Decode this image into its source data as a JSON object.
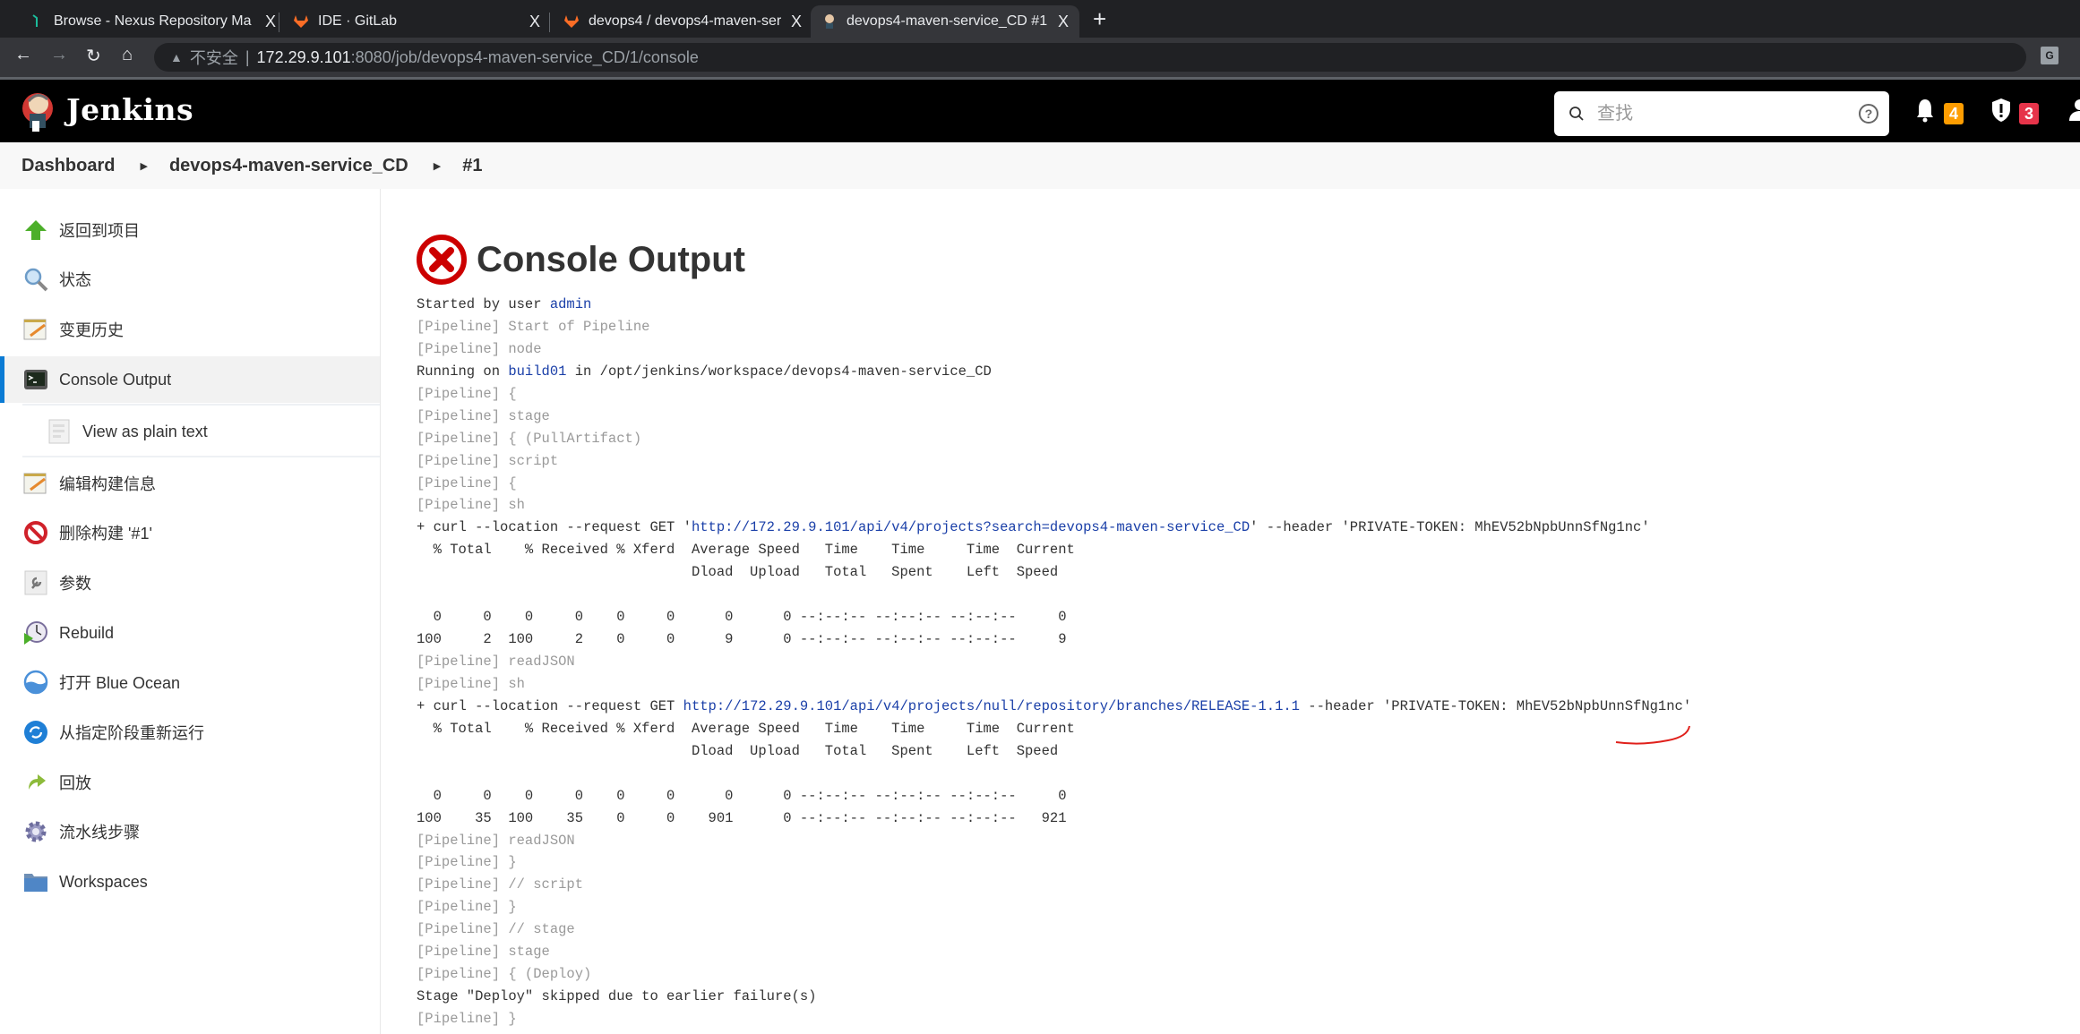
{
  "browser": {
    "tabs": [
      {
        "title": "Browse - Nexus Repository Ma",
        "icon": "nexus-icon",
        "active": false
      },
      {
        "title": "IDE · GitLab",
        "icon": "gitlab-icon",
        "active": false
      },
      {
        "title": "devops4 / devops4-maven-ser",
        "icon": "gitlab-icon",
        "active": false
      },
      {
        "title": "devops4-maven-service_CD #1",
        "icon": "jenkins-icon",
        "active": true
      }
    ],
    "close_glyph": "X",
    "new_tab_glyph": "+",
    "address": {
      "security_label": "不安全",
      "host": "172.29.9.101",
      "rest": ":8080/job/devops4-maven-service_CD/1/console"
    }
  },
  "header": {
    "brand": "Jenkins",
    "search_placeholder": "查找",
    "help_glyph": "?",
    "notifications_count": "4",
    "security_count": "3",
    "colors": {
      "notification_badge": "#fe9d01",
      "security_badge": "#e6344a"
    }
  },
  "breadcrumbs": [
    {
      "label": "Dashboard"
    },
    {
      "label": "devops4-maven-service_CD"
    },
    {
      "label": "#1"
    }
  ],
  "sidebar": {
    "items": [
      {
        "label": "返回到项目",
        "icon": "up-arrow-icon"
      },
      {
        "label": "状态",
        "icon": "magnifier-icon"
      },
      {
        "label": "变更历史",
        "icon": "notepad-icon"
      },
      {
        "label": "Console Output",
        "icon": "terminal-icon",
        "active": true
      },
      {
        "label": "View as plain text",
        "icon": "document-icon",
        "sub": true
      },
      {
        "label": "编辑构建信息",
        "icon": "notepad-icon"
      },
      {
        "label": "删除构建 '#1'",
        "icon": "no-entry-icon"
      },
      {
        "label": "参数",
        "icon": "wrench-icon"
      },
      {
        "label": "Rebuild",
        "icon": "rebuild-clock-icon"
      },
      {
        "label": "打开 Blue Ocean",
        "icon": "blue-ocean-icon"
      },
      {
        "label": "从指定阶段重新运行",
        "icon": "restart-icon"
      },
      {
        "label": "回放",
        "icon": "replay-arrow-icon"
      },
      {
        "label": "流水线步骤",
        "icon": "gear-icon"
      },
      {
        "label": "Workspaces",
        "icon": "folder-icon"
      }
    ]
  },
  "main": {
    "title": "Console Output",
    "status": "failed",
    "console": [
      {
        "parts": [
          {
            "t": "Started by user "
          },
          {
            "t": "admin",
            "link": true
          }
        ]
      },
      {
        "parts": [
          {
            "t": "[Pipeline] Start of Pipeline",
            "pl": true
          }
        ]
      },
      {
        "parts": [
          {
            "t": "[Pipeline] node",
            "pl": true
          }
        ]
      },
      {
        "parts": [
          {
            "t": "Running on "
          },
          {
            "t": "build01",
            "link": true
          },
          {
            "t": " in /opt/jenkins/workspace/devops4-maven-service_CD"
          }
        ]
      },
      {
        "parts": [
          {
            "t": "[Pipeline] {",
            "pl": true
          }
        ]
      },
      {
        "parts": [
          {
            "t": "[Pipeline] stage",
            "pl": true
          }
        ]
      },
      {
        "parts": [
          {
            "t": "[Pipeline] { (PullArtifact)",
            "pl": true
          }
        ]
      },
      {
        "parts": [
          {
            "t": "[Pipeline] script",
            "pl": true
          }
        ]
      },
      {
        "parts": [
          {
            "t": "[Pipeline] {",
            "pl": true
          }
        ]
      },
      {
        "parts": [
          {
            "t": "[Pipeline] sh",
            "pl": true
          }
        ]
      },
      {
        "parts": [
          {
            "t": "+ curl --location --request GET '"
          },
          {
            "t": "http://172.29.9.101/api/v4/projects?search=devops4-maven-service_CD",
            "link": true
          },
          {
            "t": "' --header 'PRIVATE-TOKEN: MhEV52bNpbUnnSfNg1nc'"
          }
        ]
      },
      {
        "parts": [
          {
            "t": "  % Total    % Received % Xferd  Average Speed   Time    Time     Time  Current"
          }
        ]
      },
      {
        "parts": [
          {
            "t": "                                 Dload  Upload   Total   Spent    Left  Speed"
          }
        ]
      },
      {
        "parts": [
          {
            "t": ""
          }
        ]
      },
      {
        "parts": [
          {
            "t": "  0     0    0     0    0     0      0      0 --:--:-- --:--:-- --:--:--     0"
          }
        ]
      },
      {
        "parts": [
          {
            "t": "100     2  100     2    0     0      9      0 --:--:-- --:--:-- --:--:--     9"
          }
        ]
      },
      {
        "parts": [
          {
            "t": "[Pipeline] readJSON",
            "pl": true
          }
        ]
      },
      {
        "parts": [
          {
            "t": "[Pipeline] sh",
            "pl": true
          }
        ]
      },
      {
        "parts": [
          {
            "t": "+ curl --location --request GET "
          },
          {
            "t": "http://172.29.9.101/api/v4/projects/null/repository/branches/RELEASE-1.1.1",
            "link": true
          },
          {
            "t": " --header 'PRIVATE-TOKEN: MhEV52bNpbUnnSfNg1nc'"
          }
        ]
      },
      {
        "parts": [
          {
            "t": "  % Total    % Received % Xferd  Average Speed   Time    Time     Time  Current"
          }
        ]
      },
      {
        "parts": [
          {
            "t": "                                 Dload  Upload   Total   Spent    Left  Speed"
          }
        ]
      },
      {
        "parts": [
          {
            "t": ""
          }
        ]
      },
      {
        "parts": [
          {
            "t": "  0     0    0     0    0     0      0      0 --:--:-- --:--:-- --:--:--     0"
          }
        ]
      },
      {
        "parts": [
          {
            "t": "100    35  100    35    0     0    901      0 --:--:-- --:--:-- --:--:--   921"
          }
        ]
      },
      {
        "parts": [
          {
            "t": "[Pipeline] readJSON",
            "pl": true
          }
        ]
      },
      {
        "parts": [
          {
            "t": "[Pipeline] }",
            "pl": true
          }
        ]
      },
      {
        "parts": [
          {
            "t": "[Pipeline] // script",
            "pl": true
          }
        ]
      },
      {
        "parts": [
          {
            "t": "[Pipeline] }",
            "pl": true
          }
        ]
      },
      {
        "parts": [
          {
            "t": "[Pipeline] // stage",
            "pl": true
          }
        ]
      },
      {
        "parts": [
          {
            "t": "[Pipeline] stage",
            "pl": true
          }
        ]
      },
      {
        "parts": [
          {
            "t": "[Pipeline] { (Deploy)",
            "pl": true
          }
        ]
      },
      {
        "parts": [
          {
            "t": "Stage \"Deploy\" skipped due to earlier failure(s)"
          }
        ]
      },
      {
        "parts": [
          {
            "t": "[Pipeline] }",
            "pl": true
          }
        ]
      }
    ]
  }
}
